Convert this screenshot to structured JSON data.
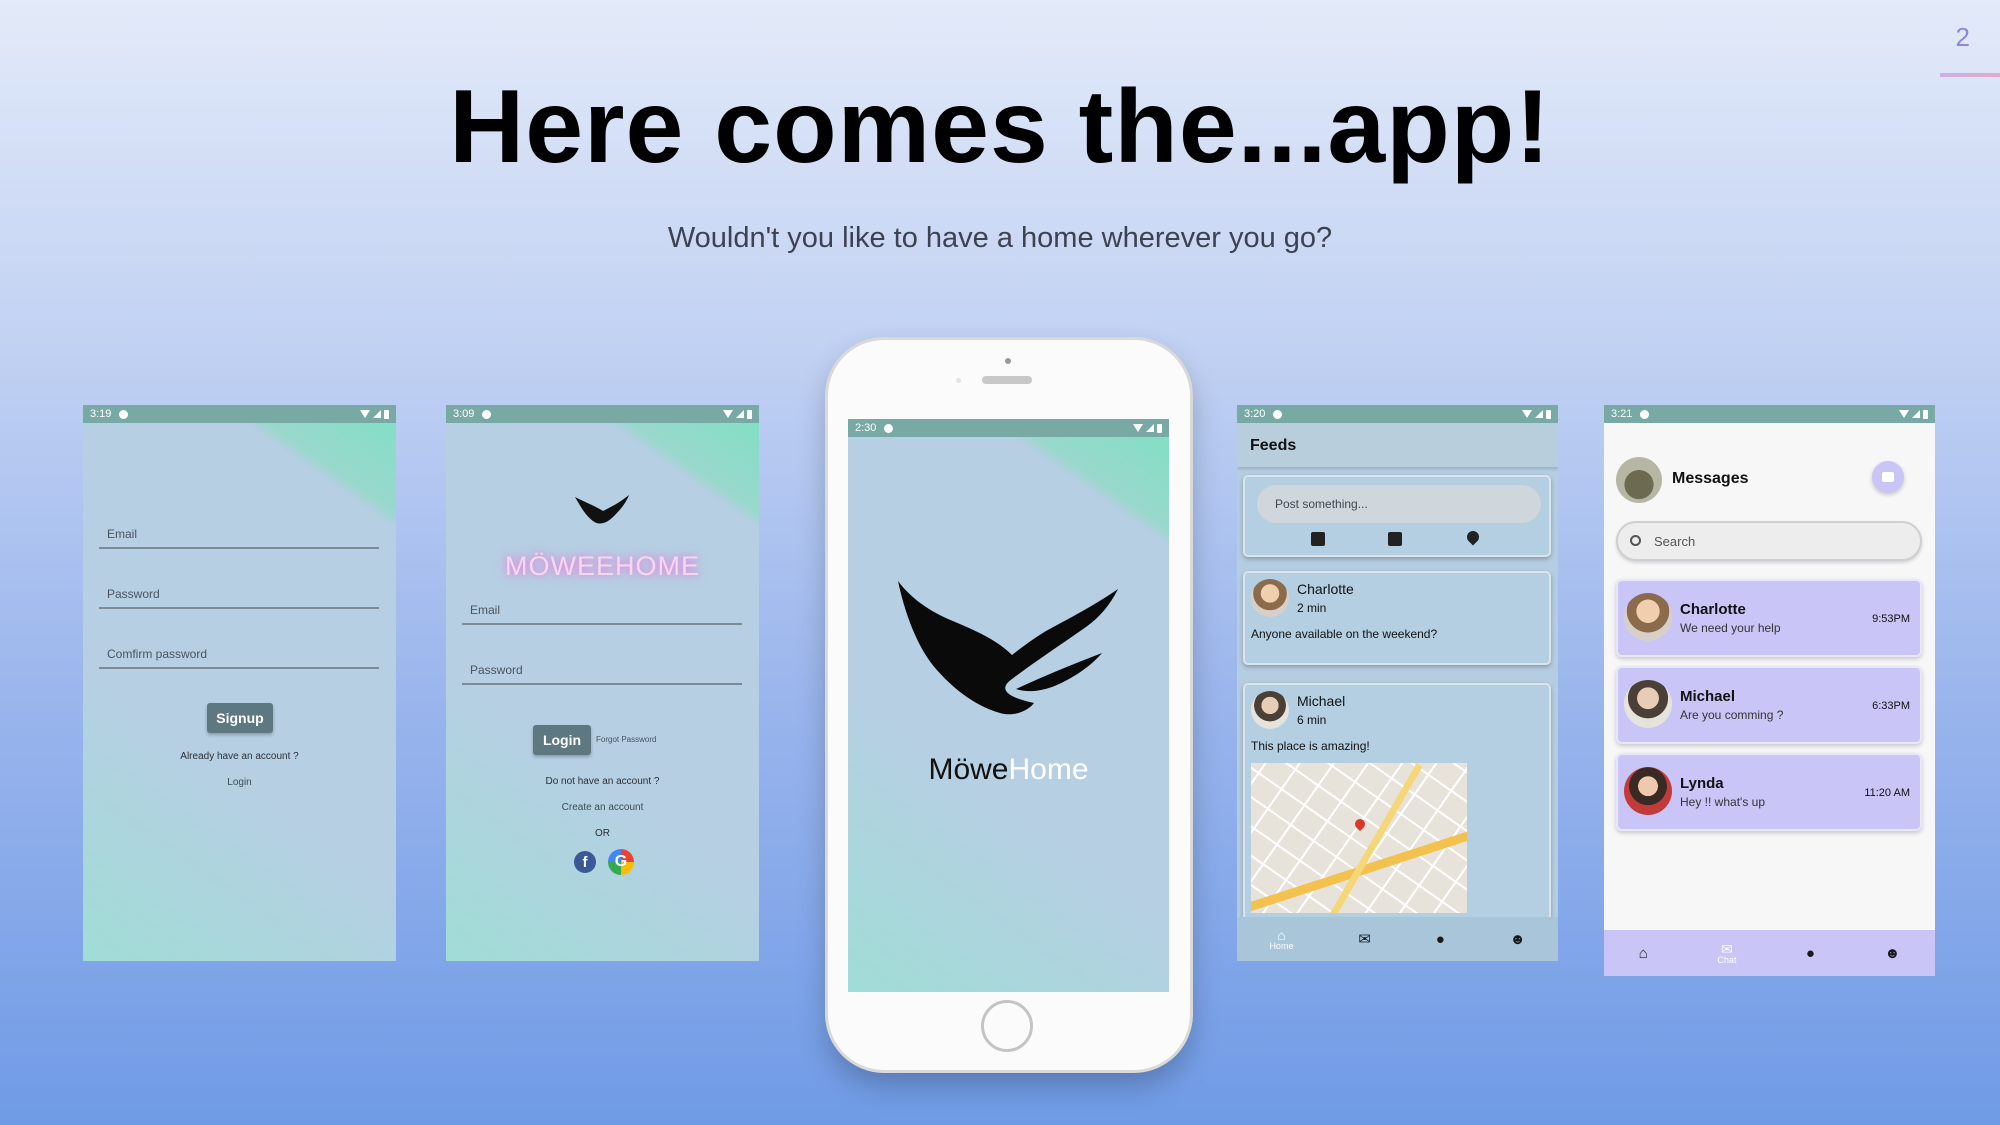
{
  "slide": {
    "number": "2",
    "title": "Here comes the...app!",
    "subtitle": "Wouldn't you like to have a home wherever you go?"
  },
  "signup_screen": {
    "time": "3:19",
    "email_label": "Email",
    "password_label": "Password",
    "confirm_label": "Comfirm password",
    "signup_button": "Signup",
    "already_text": "Already have an account ?",
    "login_link": "Login"
  },
  "login_screen": {
    "time": "3:09",
    "brand": "MÖWEEHOME",
    "email_label": "Email",
    "password_label": "Password",
    "login_button": "Login",
    "forgot_link": "Forgot Password",
    "no_account_text": "Do not have an account ?",
    "create_link": "Create an account",
    "or_text": "OR",
    "facebook_letter": "f",
    "google_letter": "G"
  },
  "splash_screen": {
    "time": "2:30",
    "brand_part1": "Möwe",
    "brand_part2": "Home"
  },
  "feeds_screen": {
    "time": "3:20",
    "title": "Feeds",
    "post_placeholder": "Post something...",
    "posts": [
      {
        "author": "Charlotte",
        "time": "2 min",
        "text": "Anyone available on the weekend?"
      },
      {
        "author": "Michael",
        "time": "6 min",
        "text": "This place is amazing!"
      }
    ],
    "nav_home": "Home"
  },
  "messages_screen": {
    "time": "3:21",
    "title": "Messages",
    "search_placeholder": "Search",
    "conversations": [
      {
        "name": "Charlotte",
        "preview": "We need your help",
        "time": "9:53PM"
      },
      {
        "name": "Michael",
        "preview": "Are you comming ?",
        "time": "6:33PM"
      },
      {
        "name": "Lynda",
        "preview": "Hey !! what's up",
        "time": "11:20 AM"
      }
    ],
    "nav_chat": "Chat"
  },
  "colors": {
    "accent_lavender": "#c9c5f7",
    "status_bar": "#78a9a5",
    "button_dark": "#5e7882"
  }
}
